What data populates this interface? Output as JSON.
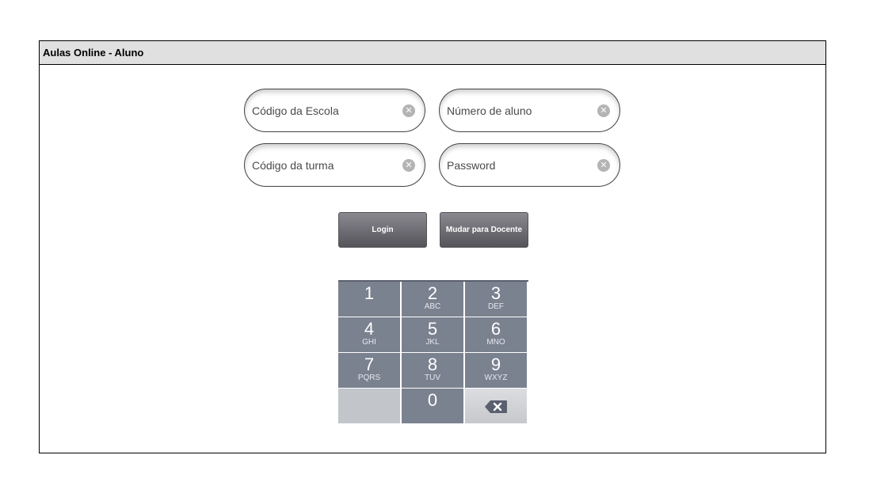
{
  "window": {
    "title": "Aulas Online - Aluno"
  },
  "form": {
    "school_code": {
      "placeholder": "Código da Escola",
      "value": ""
    },
    "student_number": {
      "placeholder": "Número de aluno",
      "value": ""
    },
    "class_code": {
      "placeholder": "Código da turma",
      "value": ""
    },
    "password": {
      "placeholder": "Password",
      "value": ""
    },
    "clear_icon": "circle-x-icon"
  },
  "buttons": {
    "login": "Login",
    "switch": "Mudar para Docente"
  },
  "keypad": {
    "keys": [
      {
        "num": "1",
        "letters": ""
      },
      {
        "num": "2",
        "letters": "ABC"
      },
      {
        "num": "3",
        "letters": "DEF"
      },
      {
        "num": "4",
        "letters": "GHI"
      },
      {
        "num": "5",
        "letters": "JKL"
      },
      {
        "num": "6",
        "letters": "MNO"
      },
      {
        "num": "7",
        "letters": "PQRS"
      },
      {
        "num": "8",
        "letters": "TUV"
      },
      {
        "num": "9",
        "letters": "WXYZ"
      },
      {
        "num": "0",
        "letters": ""
      }
    ],
    "delete_icon": "backspace-icon"
  },
  "colors": {
    "key": "#7a818f",
    "button_top": "#8a8990",
    "button_bottom": "#55545b",
    "titlebar": "#e0e0e0"
  }
}
